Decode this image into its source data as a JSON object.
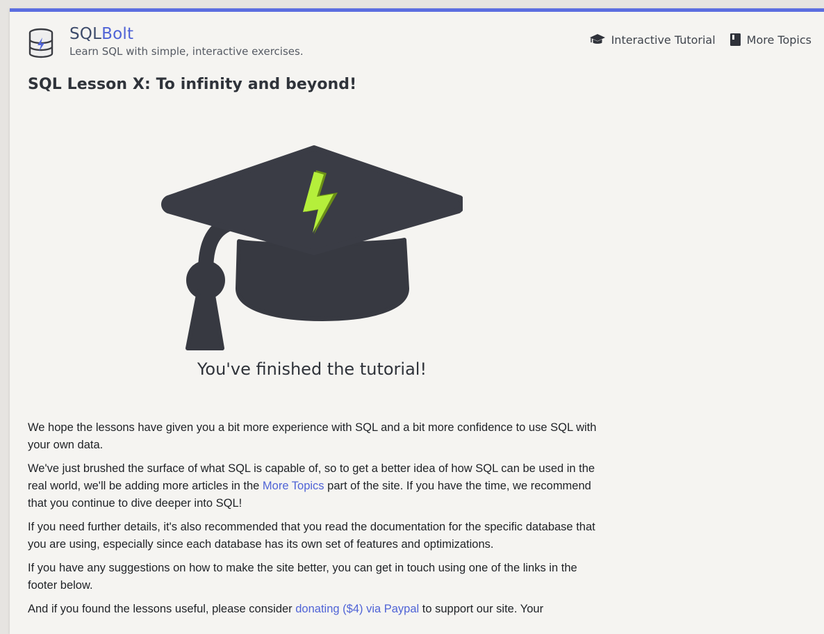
{
  "header": {
    "brand_prefix": "SQL",
    "brand_suffix": "Bolt",
    "tagline": "Learn SQL with simple, interactive exercises.",
    "logo_icon": "database-bolt-icon",
    "nav": [
      {
        "label": "Interactive Tutorial",
        "icon": "graduation-cap-icon"
      },
      {
        "label": "More Topics",
        "icon": "book-icon"
      }
    ]
  },
  "lesson": {
    "title": "SQL Lesson X: To infinity and beyond!",
    "illustration": "graduation-cap-bolt-icon",
    "finished_text": "You've finished the tutorial!"
  },
  "body": {
    "p1": "We hope the lessons have given you a bit more experience with SQL and a bit more confidence to use SQL with your own data.",
    "p2_before": "We've just brushed the surface of what SQL is capable of, so to get a better idea of how SQL can be used in the real world, we'll be adding more articles in the ",
    "p2_link": "More Topics",
    "p2_after": " part of the site. If you have the time, we recommend that you continue to dive deeper into SQL!",
    "p3": "If you need further details, it's also recommended that you read the documentation for the specific database that you are using, especially since each database has its own set of features and optimizations.",
    "p4": "If you have any suggestions on how to make the site better, you can get in touch using one of the links in the footer below.",
    "p5_before": "And if you found the lessons useful, please consider ",
    "p5_link": "donating ($4) via Paypal",
    "p5_after": " to support our site. Your"
  },
  "colors": {
    "accent": "#4f63d6",
    "top_bar": "#5b6de0",
    "cap_dark": "#373941",
    "bolt_green": "#a6e22e",
    "page_bg": "#f5f4f1"
  }
}
